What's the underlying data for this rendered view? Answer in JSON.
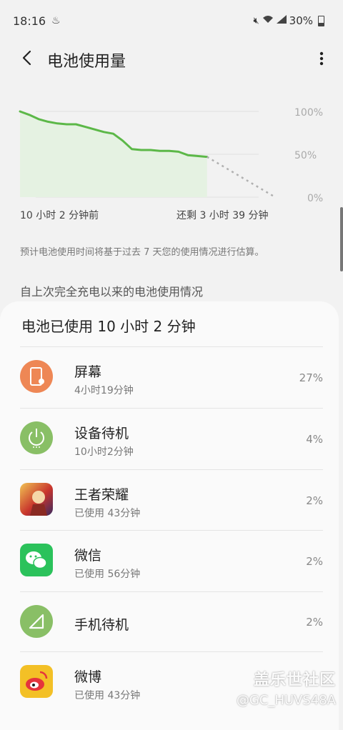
{
  "status_bar": {
    "time": "18:16",
    "battery_percent": "30%",
    "icons": [
      "notification-app-icon",
      "mute-icon",
      "wifi-icon",
      "signal-icon",
      "battery-icon"
    ]
  },
  "app_bar": {
    "title": "电池使用量"
  },
  "chart": {
    "y_labels": [
      "100%",
      "50%",
      "0%"
    ],
    "x_start": "10 小时 2 分钟前",
    "x_end": "还剩 3 小时 39 分钟",
    "line_color": "#5cb848",
    "fill_color": "#e5f2e2",
    "projection_color": "#b0b0b0"
  },
  "chart_data": {
    "type": "area",
    "x": [
      0,
      0.5,
      1,
      1.5,
      2,
      2.5,
      3,
      3.5,
      4,
      4.5,
      5,
      5.5,
      6,
      6.5,
      7,
      7.5,
      8,
      8.5,
      9,
      9.5,
      10.03
    ],
    "series": [
      {
        "values": [
          100,
          96,
          91,
          88,
          86,
          85,
          85,
          82,
          79,
          76,
          74,
          66,
          56,
          55,
          55,
          54,
          54,
          53,
          49,
          48,
          47
        ]
      },
      {
        "values": [
          47,
          0
        ]
      }
    ],
    "projection_x": [
      10.03,
      13.68
    ],
    "ylim": [
      0,
      100
    ],
    "grid": true
  },
  "labels": {
    "note": "预计电池使用时间将基于过去 7 天您的使用情况进行估算。",
    "section_title": "自上次完全充电以来的电池使用情况",
    "card_title": "电池已使用 10 小时 2 分钟"
  },
  "items": [
    {
      "name": "屏幕",
      "sub": "4小时19分钟",
      "pct": "27%",
      "icon": "screen-icon",
      "color": "#ee8755"
    },
    {
      "name": "设备待机",
      "sub": "10小时2分钟",
      "pct": "4%",
      "icon": "power-icon",
      "color": "#89bf66"
    },
    {
      "name": "王者荣耀",
      "sub": "已使用 43分钟",
      "pct": "2%",
      "icon": "game-app-icon",
      "color": "#c8342c"
    },
    {
      "name": "微信",
      "sub": "已使用 56分钟",
      "pct": "2%",
      "icon": "wechat-icon",
      "color": "#2bc25b"
    },
    {
      "name": "手机待机",
      "sub": "",
      "pct": "2%",
      "icon": "cell-standby-icon",
      "color": "#89bf66"
    },
    {
      "name": "微博",
      "sub": "已使用 43分钟",
      "pct": "",
      "icon": "weibo-icon",
      "color": "#e5343c"
    }
  ],
  "watermark": {
    "line1": "盖乐世社区",
    "line2": "@GC_HUVS48A"
  }
}
